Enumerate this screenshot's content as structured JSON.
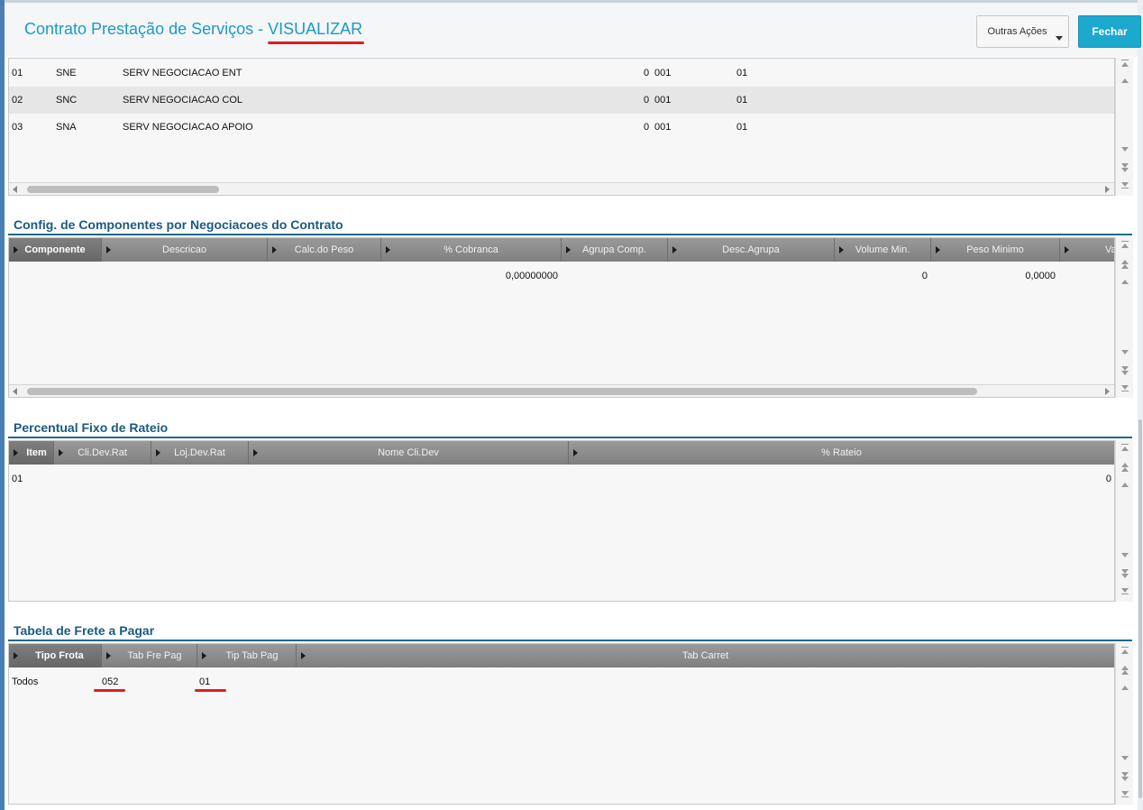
{
  "header": {
    "title": "Contrato Prestação de Serviços - ",
    "mode": "VISUALIZAR",
    "outras_acoes": "Outras Ações",
    "fechar": "Fechar"
  },
  "negociacoes": {
    "rows": [
      [
        "01",
        "SNE",
        "SERV NEGOCIACAO ENT",
        "0",
        "001",
        "01"
      ],
      [
        "02",
        "SNC",
        "SERV NEGOCIACAO COL",
        "0",
        "001",
        "01"
      ],
      [
        "03",
        "SNA",
        "SERV NEGOCIACAO APOIO",
        "0",
        "001",
        "01"
      ]
    ]
  },
  "componentes": {
    "title": "Config. de Componentes por Negociacoes do Contrato",
    "columns": [
      "Componente",
      "Descricao",
      "Calc.do Peso",
      "% Cobranca",
      "Agrupa Comp.",
      "Desc.Agrupa",
      "Volume Min.",
      "Peso Minimo",
      "Va"
    ],
    "row": {
      "cobranca": "0,00000000",
      "volume_min": "0",
      "peso_minimo": "0,0000"
    }
  },
  "rateio": {
    "title": "Percentual Fixo de Rateio",
    "columns": [
      "Item",
      "Cli.Dev.Rat",
      "Loj.Dev.Rat",
      "Nome Cli.Dev",
      "% Rateio"
    ],
    "row": {
      "item": "01",
      "rateio": "0"
    }
  },
  "frete": {
    "title": "Tabela de Frete a Pagar",
    "columns": [
      "Tipo Frota",
      "Tab Fre Pag",
      "Tip Tab Pag",
      "Tab Carret"
    ],
    "row": {
      "tipo_frota": "Todos",
      "tab_fre_pag": "052",
      "tip_tab_pag": "01"
    }
  },
  "colors": {
    "title": "#1a9bc4",
    "accent_button": "#1da8ce",
    "section_title": "#1b5a80",
    "highlight_mark": "#e31b23"
  }
}
